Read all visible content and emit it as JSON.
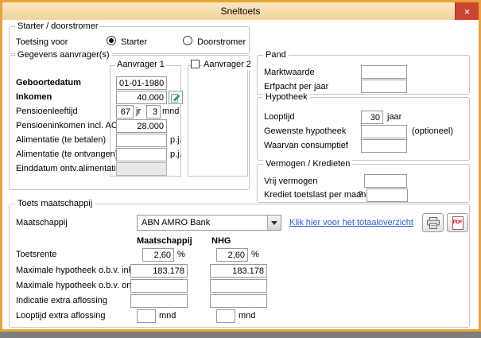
{
  "window": {
    "title": "Sneltoets",
    "close": "×"
  },
  "starter": {
    "title": "Starter / doorstromer",
    "label": "Toetsing voor",
    "starter": "Starter",
    "doorstromer": "Doorstromer"
  },
  "aanvragers": {
    "title": "Gegevens aanvrager(s)",
    "aanvrager1": "Aanvrager 1",
    "aanvrager2": "Aanvrager 2",
    "geboortedatum_label": "Geboortedatum",
    "geboortedatum_value": "01-01-1980",
    "inkomen_label": "Inkomen",
    "inkomen_value": "40.000",
    "pensioenleeftijd_label": "Pensioenleeftijd",
    "pensioenleeftijd_jaar": "67",
    "jr": "jr",
    "pensioenleeftijd_maand": "3",
    "mnd": "mnd",
    "pensioeninkomen_label": "Pensioeninkomen incl. AOW",
    "pensioeninkomen_value": "28.000",
    "alimentatie_betalen_label": "Alimentatie (te betalen)",
    "alimentatie_betalen_value": "",
    "alimentatie_ontvangen_label": "Alimentatie (te ontvangen)",
    "alimentatie_ontvangen_value": "",
    "pj": "p.j.",
    "einddatum_label": "Einddatum ontv.alimentatie",
    "einddatum_value": ""
  },
  "pand": {
    "title": "Pand",
    "marktwaarde_label": "Marktwaarde",
    "marktwaarde_value": "",
    "erfpacht_label": "Erfpacht per jaar",
    "erfpacht_value": ""
  },
  "hypotheek": {
    "title": "Hypotheek",
    "looptijd_label": "Looptijd",
    "looptijd_value": "30",
    "jaar": "jaar",
    "gewenste_label": "Gewenste hypotheek",
    "gewenste_value": "",
    "optioneel": "(optioneel)",
    "consumptief_label": "Waarvan consumptief",
    "consumptief_value": ""
  },
  "vermogen": {
    "title": "Vermogen / Kredieten",
    "vrij_label": "Vrij vermogen",
    "vrij_value": "",
    "krediet_label": "Krediet toetslast per maand",
    "vraagteken": "?",
    "krediet_value": ""
  },
  "toets": {
    "title": "Toets maatschappij",
    "maatschappij_label": "Maatschappij",
    "maatschappij_value": "ABN AMRO Bank",
    "link": "Klik hier voor het totaaloverzicht",
    "pdf_icon_text": "PDF",
    "col_maatschappij": "Maatschappij",
    "col_nhg": "NHG",
    "rows": [
      {
        "label": "Toetsrente",
        "v1": "2,60",
        "v2": "2,60",
        "suffix": "%"
      },
      {
        "label": "Maximale hypotheek o.b.v. inkomen",
        "v1": "183.178",
        "v2": "183.178"
      },
      {
        "label": "Maximale hypotheek o.b.v. onderpand",
        "v1": "",
        "v2": ""
      },
      {
        "label": "Indicatie extra aflossing",
        "v1": "",
        "v2": ""
      },
      {
        "label": "Looptijd extra aflossing",
        "v1": "",
        "v2": "",
        "suffix": "mnd"
      }
    ]
  }
}
